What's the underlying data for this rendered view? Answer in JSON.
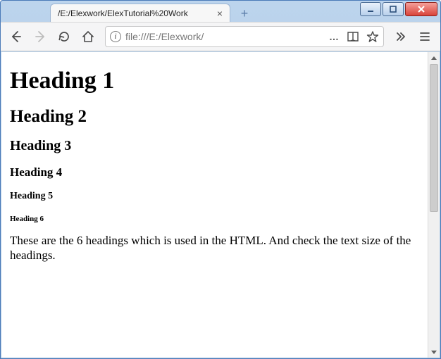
{
  "window": {
    "minimize": "minimize",
    "maximize": "maximize",
    "close": "close"
  },
  "tab": {
    "title": "/E:/Elexwork/ElexTutorial%20Work",
    "close_label": "×"
  },
  "newtab": {
    "label": "+"
  },
  "toolbar": {
    "back": "back",
    "forward": "forward",
    "reload": "reload",
    "home": "home",
    "overflow": "overflow",
    "menu": "menu"
  },
  "urlbar": {
    "info": "i",
    "url": "file:///E:/Elexwork/",
    "page_actions": "…",
    "reader": "reader",
    "star": "star"
  },
  "page": {
    "h1": "Heading 1",
    "h2": "Heading 2",
    "h3": "Heading 3",
    "h4": "Heading 4",
    "h5": "Heading 5",
    "h6": "Heading 6",
    "paragraph": "These are the 6 headings which is used in the HTML. And check the text size of the headings."
  }
}
